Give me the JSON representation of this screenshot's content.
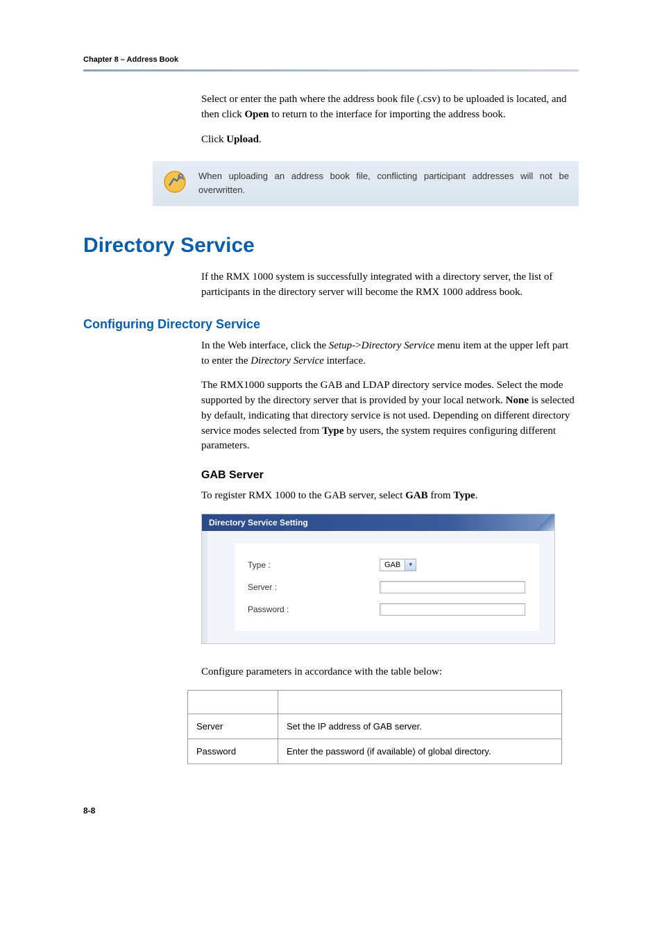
{
  "chapter_header": "Chapter 8 – Address Book",
  "intro": {
    "para1_pre": "Select or enter the path where the address book file (.csv) to be uploaded is located, and then click ",
    "para1_bold1": "Open",
    "para1_post": " to return to the interface for importing the address book.",
    "para2_pre": "Click ",
    "para2_bold": "Upload",
    "para2_post": "."
  },
  "note_text": "When uploading an address book file, conflicting participant addresses will not be overwritten.",
  "h1": "Directory Service",
  "ds_intro": "If the RMX 1000 system is successfully integrated with a directory server, the list of participants in the directory server will become the RMX 1000 address book.",
  "h2": "Configuring Directory Service",
  "cfg_para1_pre": "In the Web interface, click the ",
  "cfg_para1_it1": "Setup",
  "cfg_para1_mid": "->",
  "cfg_para1_it2": "Directory Service",
  "cfg_para1_post1": " menu item at the upper left part to enter the ",
  "cfg_para1_it3": "Directory Service",
  "cfg_para1_post2": " interface.",
  "cfg_para2_pre": "The RMX1000 supports the GAB and LDAP directory service modes. Select the mode supported by the directory server that is provided by your local network. ",
  "cfg_para2_b1": "None",
  "cfg_para2_mid": " is selected by default, indicating that directory service is not used. Depending on different directory service modes selected from ",
  "cfg_para2_b2": "Type",
  "cfg_para2_post": " by users, the system requires configuring different parameters.",
  "h3_gab": "GAB Server",
  "gab_para_pre": "To register RMX 1000 to the GAB server, select ",
  "gab_para_b1": "GAB",
  "gab_para_mid": " from ",
  "gab_para_b2": "Type",
  "gab_para_post": ".",
  "screenshot": {
    "title": "Directory Service Setting",
    "rows": {
      "type_label": "Type :",
      "type_value": "GAB",
      "server_label": "Server :",
      "server_value": "",
      "password_label": "Password :",
      "password_value": ""
    }
  },
  "table_intro": "Configure parameters in accordance with the table below:",
  "table": {
    "headers": [
      "",
      ""
    ],
    "rows": [
      {
        "param": "Server",
        "desc": "Set the IP address of GAB server."
      },
      {
        "param": "Password",
        "desc": "Enter the password (if available) of global directory."
      }
    ]
  },
  "page_num": "8-8"
}
